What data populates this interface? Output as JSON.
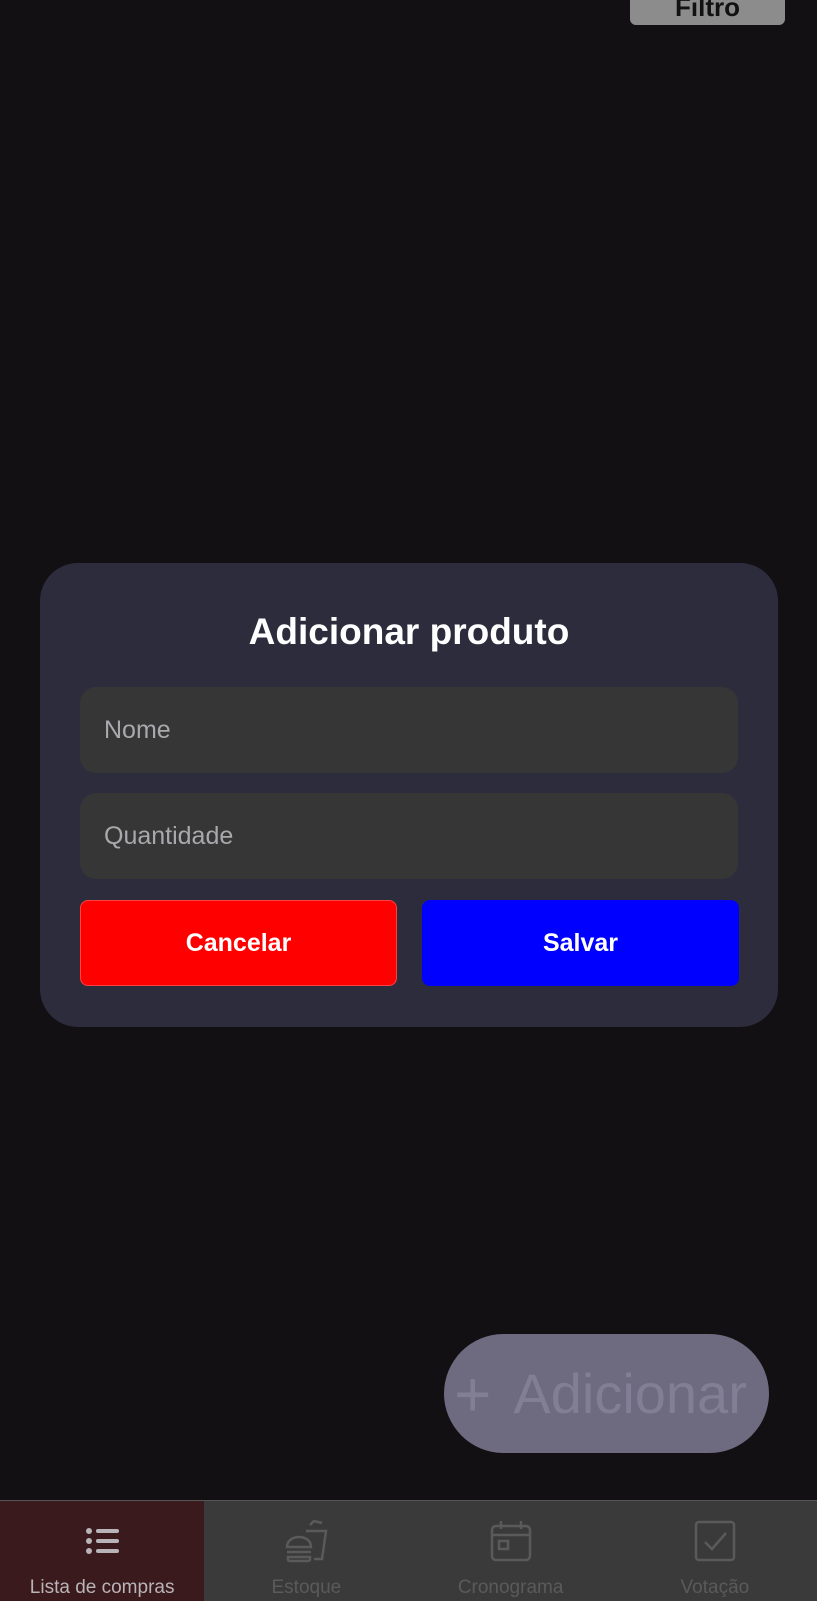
{
  "background": {
    "filter_button_label": "Filtro",
    "fab": {
      "icon": "plus-icon",
      "label": "Adicionar"
    }
  },
  "dialog": {
    "title": "Adicionar produto",
    "name_field": {
      "value": "",
      "placeholder": "Nome"
    },
    "quantity_field": {
      "value": "",
      "placeholder": "Quantidade"
    },
    "cancel_label": "Cancelar",
    "save_label": "Salvar"
  },
  "bottom_nav": {
    "items": [
      {
        "label": "Lista de compras",
        "icon": "list-icon",
        "active": true
      },
      {
        "label": "Estoque",
        "icon": "fastfood-icon",
        "active": false
      },
      {
        "label": "Cronograma",
        "icon": "calendar-icon",
        "active": false
      },
      {
        "label": "Votação",
        "icon": "checkbox-icon",
        "active": false
      }
    ]
  },
  "colors": {
    "background": "#121012",
    "dialog": "#2d2c3d",
    "field": "#363636",
    "cancel": "#ff0000",
    "save": "#0000ff",
    "nav_active": "#3a1a1c"
  }
}
